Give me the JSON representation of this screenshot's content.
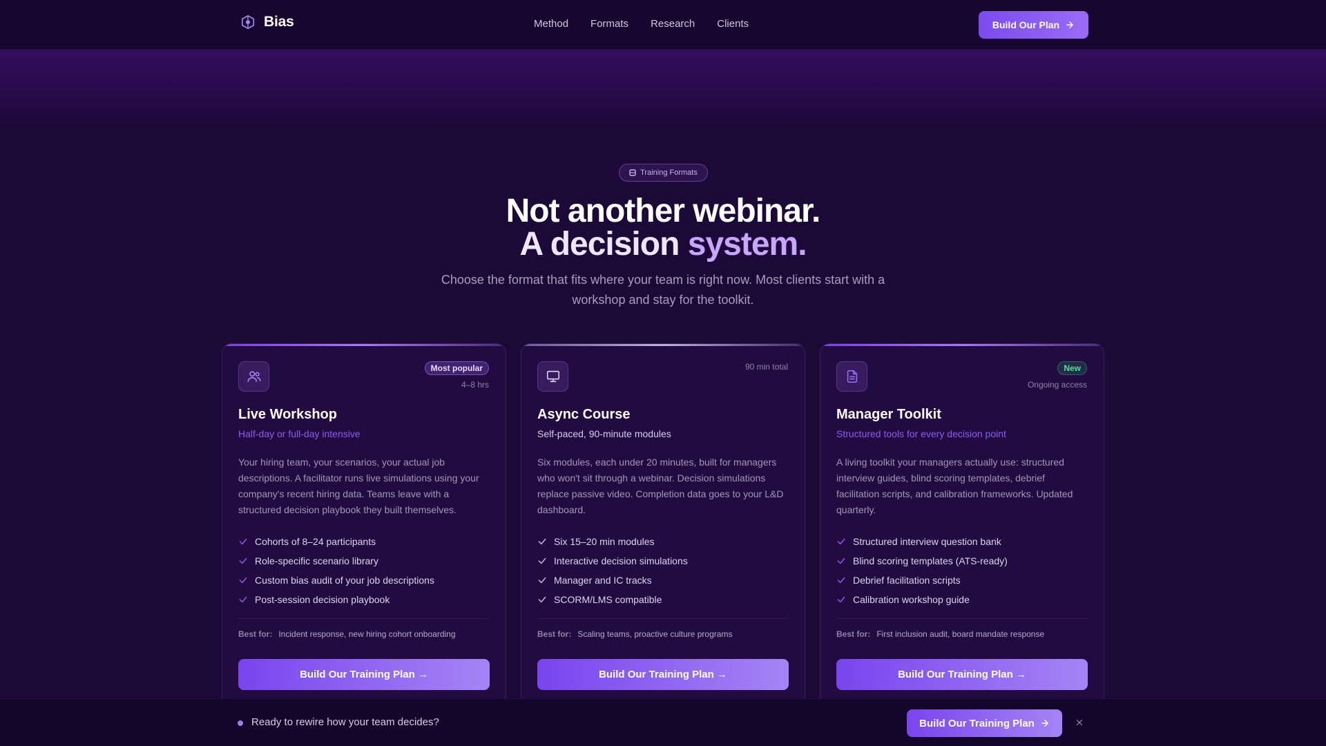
{
  "brand": {
    "name": "Bias",
    "icon": "hexagon-logo-icon"
  },
  "nav": {
    "links": [
      "Method",
      "Formats",
      "Research",
      "Clients"
    ],
    "cta_label": "Build Our Plan"
  },
  "hero": {
    "badge": "Training Formats",
    "headline_line1": "Not another webinar.",
    "headline_line2_start": "A decision ",
    "headline_line2_accent": "system.",
    "subtitle": "Choose the format that fits where your team is right now. Most clients start with a workshop and stay for the toolkit."
  },
  "cards": [
    {
      "icon": "users-icon",
      "tag": "Most popular",
      "meta": "4–8 hrs",
      "title": "Live Workshop",
      "subtitle": "Half-day or full-day intensive",
      "description": "Your hiring team, your scenarios, your actual job descriptions. A facilitator runs live simulations using your company's recent hiring data. Teams leave with a structured decision playbook they built themselves.",
      "features": [
        "Cohorts of 8–24 participants",
        "Role-specific scenario library",
        "Custom bias audit of your job descriptions",
        "Post-session decision playbook"
      ],
      "best_label": "Best for:",
      "best_value": "Incident response, new hiring cohort onboarding",
      "cta": "Build Our Training Plan →"
    },
    {
      "icon": "monitor-icon",
      "tag": "",
      "meta": "90 min total",
      "title": "Async Course",
      "subtitle": "Self-paced, 90-minute modules",
      "description": "Six modules, each under 20 minutes, built for managers who won't sit through a webinar. Decision simulations replace passive video. Completion data goes to your L&D dashboard.",
      "features": [
        "Six 15–20 min modules",
        "Interactive decision simulations",
        "Manager and IC tracks",
        "SCORM/LMS compatible"
      ],
      "best_label": "Best for:",
      "best_value": "Scaling teams, proactive culture programs",
      "cta": "Build Our Training Plan →"
    },
    {
      "icon": "document-icon",
      "tag": "New",
      "meta": "Ongoing access",
      "title": "Manager Toolkit",
      "subtitle": "Structured tools for every decision point",
      "description": "A living toolkit your managers actually use: structured interview guides, blind scoring templates, debrief facilitation scripts, and calibration frameworks. Updated quarterly.",
      "features": [
        "Structured interview question bank",
        "Blind scoring templates (ATS-ready)",
        "Debrief facilitation scripts",
        "Calibration workshop guide"
      ],
      "best_label": "Best for:",
      "best_value": "First inclusion audit, board mandate response",
      "cta": "Build Our Training Plan →"
    }
  ],
  "sticky": {
    "message": "Ready to rewire how your team decides?",
    "cta": "Build Our Training Plan"
  },
  "colors": {
    "accent": "#8b5cf6",
    "background": "#1d0938",
    "success": "#4ee39a"
  }
}
